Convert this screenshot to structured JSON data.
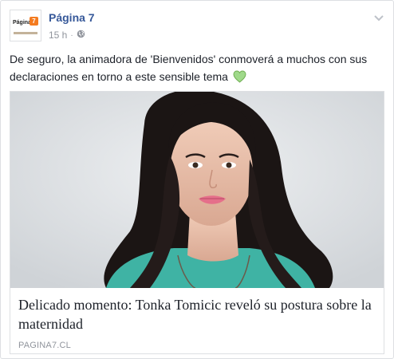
{
  "post": {
    "page_name": "Página 7",
    "timestamp": "15 h",
    "separator": "·",
    "privacy_icon": "globe-icon",
    "options_icon": "chevron-down-icon",
    "avatar": {
      "logo_text": "Página",
      "logo_number": "7"
    },
    "text": "De seguro, la animadora de 'Bienvenidos' conmoverá a muchos con sus declaraciones en torno a este sensible tema",
    "emoji": "green-heart-icon"
  },
  "link": {
    "title": "Delicado momento: Tonka Tomicic reveló su postura sobre la maternidad",
    "domain": "PAGINA7.CL",
    "image": "portrait-photo"
  },
  "colors": {
    "page_name": "#365899",
    "meta": "#90949c",
    "border": "#dddfe2",
    "accent_logo": "#f47b20",
    "emoji_heart": "#8fd16b"
  }
}
